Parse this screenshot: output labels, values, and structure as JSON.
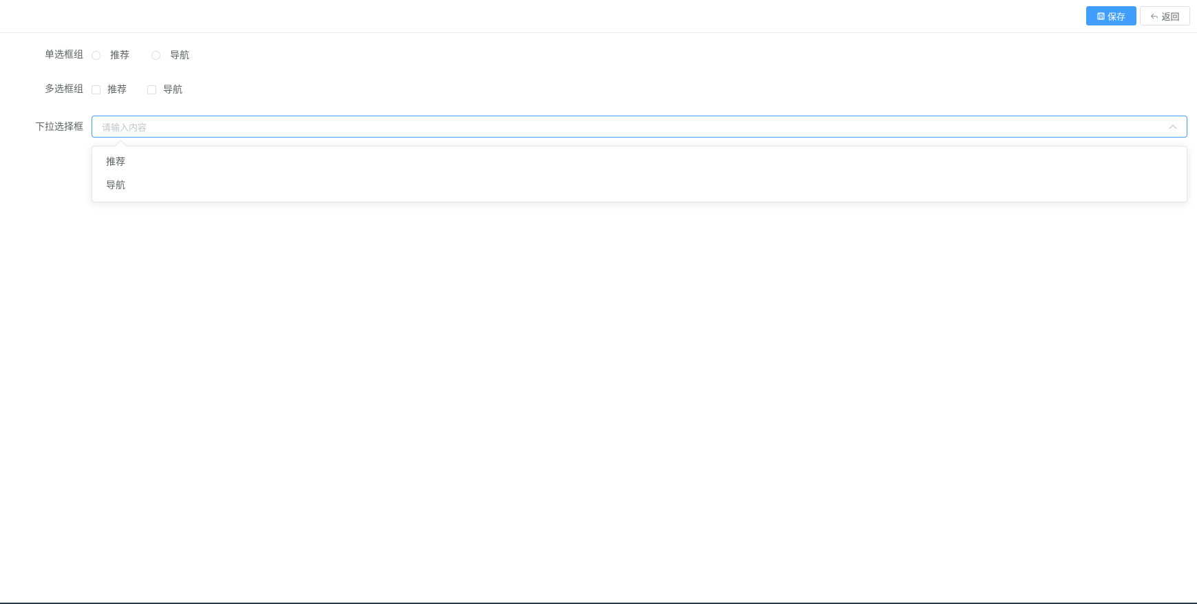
{
  "toolbar": {
    "save_label": "保存",
    "back_label": "返回",
    "accent_color": "#409eff"
  },
  "form": {
    "radio_group": {
      "label": "单选框组",
      "options": [
        "推荐",
        "导航"
      ],
      "selected": null
    },
    "checkbox_group": {
      "label": "多选框组",
      "options": [
        "推荐",
        "导航"
      ],
      "checked": []
    },
    "select": {
      "label": "下拉选择框",
      "placeholder": "请输入内容",
      "open": true,
      "options": [
        "推荐",
        "导航"
      ]
    }
  },
  "icons": {
    "save": "save-icon",
    "back": "back-arrow-icon",
    "arrow": "chevron-up-icon"
  }
}
